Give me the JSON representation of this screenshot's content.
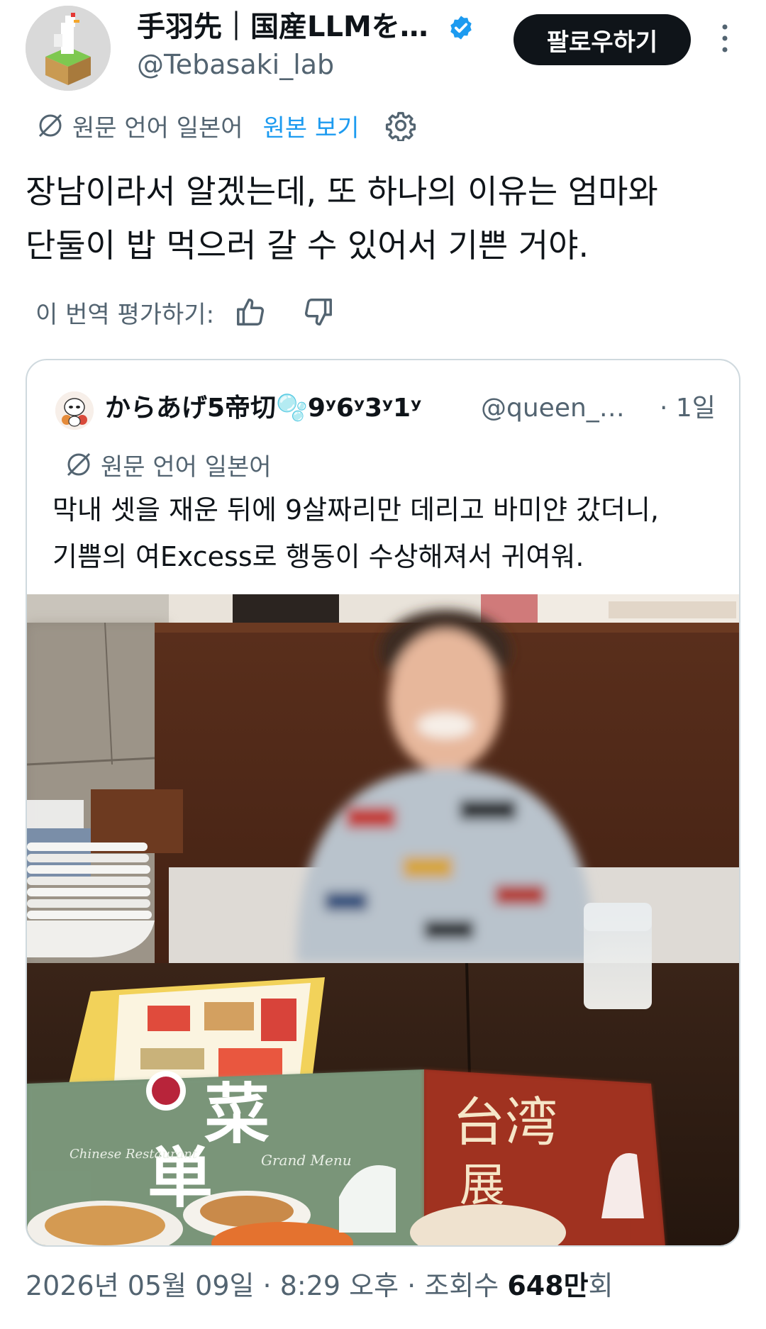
{
  "header": {
    "display_name": "手羽先｜国産LLMを…",
    "handle": "@Tebasaki_lab",
    "follow_label": "팔로우하기"
  },
  "translation": {
    "source_label": "원문 언어 일본어",
    "view_original_label": "원본 보기"
  },
  "tweet": {
    "line1": "장남이라서 알겠는데, 또 하나의 이유는 엄마와",
    "line2": "단둘이 밥 먹으러 갈 수 있어서 기쁜 거야."
  },
  "rate": {
    "label": "이 번역 평가하기:"
  },
  "quote": {
    "name": "からあげ5帝切🫧9ʸ6ʸ3ʸ1ʸ",
    "handle": "@queen_…",
    "time": "· 1일",
    "source_label": "원문 언어 일본어",
    "line1": "막내 셋을 재운 뒤에 9살짜리만 데리고 바미얀 갔더니,",
    "line2": "기쁨의 여Excess로 행동이 수상해져서 귀여워.",
    "menu_text_1": "菜",
    "menu_text_2": "単",
    "menu_text_3": "台湾",
    "menu_text_4": "展",
    "menu_small_1": "Chinese Restaurant",
    "menu_small_2": "Grand Menu"
  },
  "footer": {
    "date": "2026년 05월 09일",
    "time": "8:29 오후",
    "views_prefix": "조회수",
    "views_count": "648만",
    "views_suffix": "회"
  },
  "colors": {
    "link_blue": "#1d9bf0",
    "verified_blue": "#1d9bf0",
    "secondary_text": "#536471",
    "follow_bg": "#0f1419"
  }
}
